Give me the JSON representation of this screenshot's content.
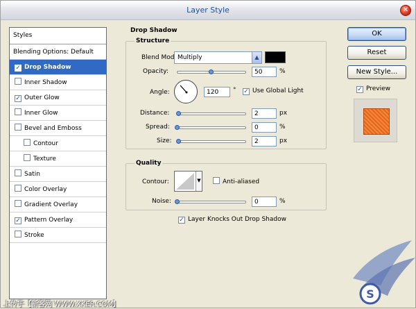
{
  "window": {
    "title": "Layer Style"
  },
  "styles_panel": {
    "header": "Styles",
    "items": [
      {
        "label": "Blending Options: Default",
        "checkbox": false,
        "checked": false,
        "selected": false,
        "indent": 0
      },
      {
        "label": "Drop Shadow",
        "checkbox": true,
        "checked": true,
        "selected": true,
        "indent": 0
      },
      {
        "label": "Inner Shadow",
        "checkbox": true,
        "checked": false,
        "selected": false,
        "indent": 0
      },
      {
        "label": "Outer Glow",
        "checkbox": true,
        "checked": true,
        "selected": false,
        "indent": 0
      },
      {
        "label": "Inner Glow",
        "checkbox": true,
        "checked": false,
        "selected": false,
        "indent": 0
      },
      {
        "label": "Bevel and Emboss",
        "checkbox": true,
        "checked": false,
        "selected": false,
        "indent": 0
      },
      {
        "label": "Contour",
        "checkbox": true,
        "checked": false,
        "selected": false,
        "indent": 1
      },
      {
        "label": "Texture",
        "checkbox": true,
        "checked": false,
        "selected": false,
        "indent": 1
      },
      {
        "label": "Satin",
        "checkbox": true,
        "checked": false,
        "selected": false,
        "indent": 0
      },
      {
        "label": "Color Overlay",
        "checkbox": true,
        "checked": false,
        "selected": false,
        "indent": 0
      },
      {
        "label": "Gradient Overlay",
        "checkbox": true,
        "checked": false,
        "selected": false,
        "indent": 0
      },
      {
        "label": "Pattern Overlay",
        "checkbox": true,
        "checked": true,
        "selected": false,
        "indent": 0
      },
      {
        "label": "Stroke",
        "checkbox": true,
        "checked": false,
        "selected": false,
        "indent": 0
      }
    ]
  },
  "drop_shadow": {
    "section_title": "Drop Shadow",
    "structure": {
      "title": "Structure",
      "blend_mode_label": "Blend Mode:",
      "blend_mode_value": "Multiply",
      "shadow_color": "#000000",
      "opacity_label": "Opacity:",
      "opacity_value": "50",
      "opacity_level": 0.5,
      "opacity_unit": "%",
      "angle_label": "Angle:",
      "angle_value": "120",
      "angle_unit": "°",
      "use_global_light_label": "Use Global Light",
      "use_global_light_checked": true,
      "distance_label": "Distance:",
      "distance_value": "2",
      "distance_unit": "px",
      "spread_label": "Spread:",
      "spread_value": "0",
      "spread_unit": "%",
      "size_label": "Size:",
      "size_value": "2",
      "size_unit": "px"
    },
    "quality": {
      "title": "Quality",
      "contour_label": "Contour:",
      "anti_aliased_label": "Anti-aliased",
      "anti_aliased_checked": false,
      "noise_label": "Noise:",
      "noise_value": "0",
      "noise_unit": "%"
    },
    "knockout_label": "Layer Knocks Out Drop Shadow",
    "knockout_checked": true
  },
  "buttons": {
    "ok": "OK",
    "reset": "Reset",
    "new_style": "New Style...",
    "preview_label": "Preview",
    "preview_checked": true
  },
  "watermark": {
    "text": "上传于【新客网 WWW.XKER.COM】",
    "logo_text": "S"
  },
  "colors": {
    "selected_item": "#316ac5",
    "pattern_orange": "#e8641c",
    "title_text": "#1f4f98"
  }
}
